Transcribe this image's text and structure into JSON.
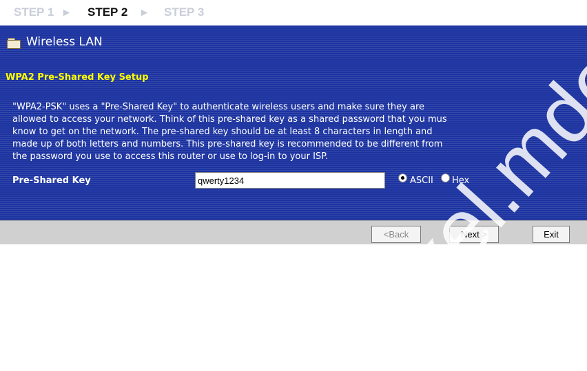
{
  "steps": [
    {
      "label": "STEP 1",
      "active": false
    },
    {
      "label": "STEP 2",
      "active": true
    },
    {
      "label": "STEP 3",
      "active": false
    }
  ],
  "step_separator": "▸",
  "header": {
    "title": "Wireless LAN"
  },
  "section_title": "WPA2 Pre-Shared Key Setup",
  "description_lines": [
    "\"WPA2-PSK\" uses a \"Pre-Shared Key\" to authenticate wireless users and make sure they are",
    "allowed to access your network. Think of this pre-shared key as a shared password that you mus",
    "know to get on the network. The pre-shared key should be at least 8 characters in length and",
    "made up of both letters and numbers. This pre-shared key is recommended to be different from",
    "the password you use to access this router or use to log-in to your ISP."
  ],
  "psk": {
    "label": "Pre-Shared Key",
    "value": "qwerty1234"
  },
  "radios": [
    {
      "label": "ASCII",
      "checked": true
    },
    {
      "label": "Hex",
      "checked": false
    }
  ],
  "buttons": {
    "back": "<Back",
    "next": "Next >",
    "exit": "Exit"
  },
  "watermark": "zyxel.mde",
  "colors": {
    "panel": "#1c33a0",
    "section_title": "#ffff00",
    "footer": "#d0d0d0"
  }
}
